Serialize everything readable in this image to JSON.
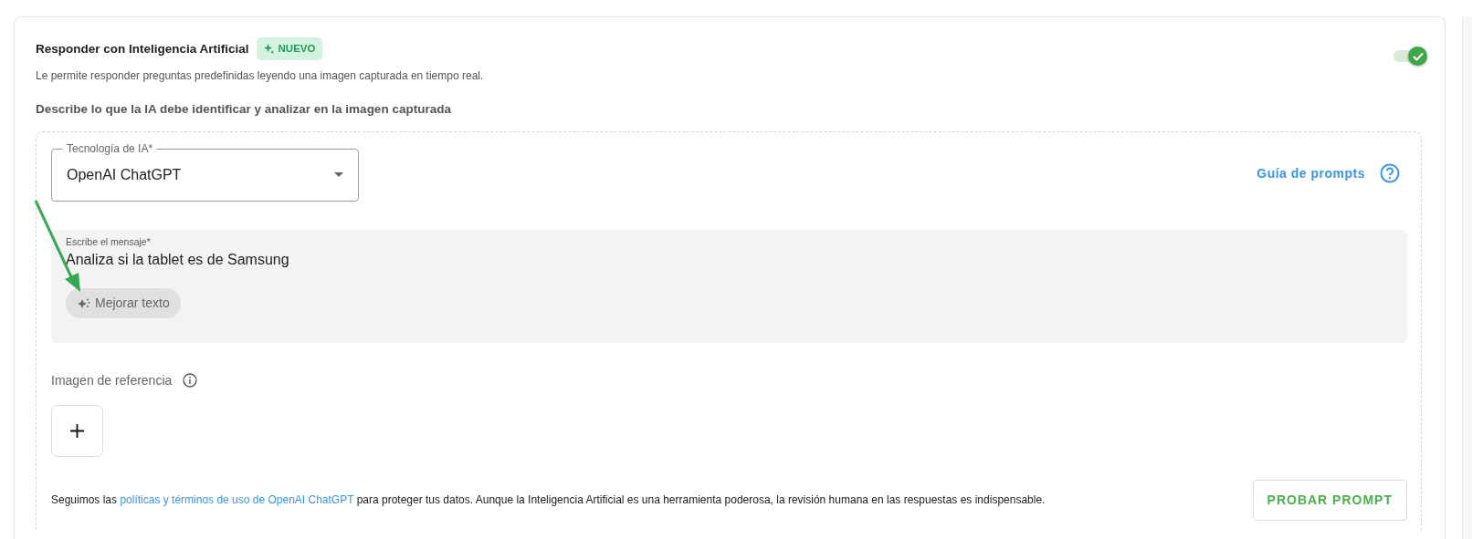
{
  "section": {
    "title": "Responder con Inteligencia Artificial",
    "badge": "NUEVO",
    "description": "Le permite responder preguntas predefinidas leyendo una imagen capturada en tiempo real.",
    "enabled": true,
    "prompt_heading": "Describe lo que la IA debe identificar y analizar en la imagen capturada"
  },
  "ai_technology": {
    "label": "Tecnología de IA*",
    "value": "OpenAI ChatGPT"
  },
  "prompt_guide_link": "Guía de prompts",
  "message": {
    "label": "Escribe el mensaje*",
    "value": "Analiza si la tablet es de Samsung",
    "improve_button": "Mejorar texto"
  },
  "reference_image": {
    "label": "Imagen de referencia"
  },
  "disclaimer": {
    "before": "Seguimos las ",
    "link": "políticas y términos de uso de OpenAI ChatGPT",
    "after": " para proteger tus datos. Aunque la Inteligencia Artificial es una herramienta poderosa, la revisión humana en las respuestas es indispensable."
  },
  "test_button": "PROBAR PROMPT"
}
